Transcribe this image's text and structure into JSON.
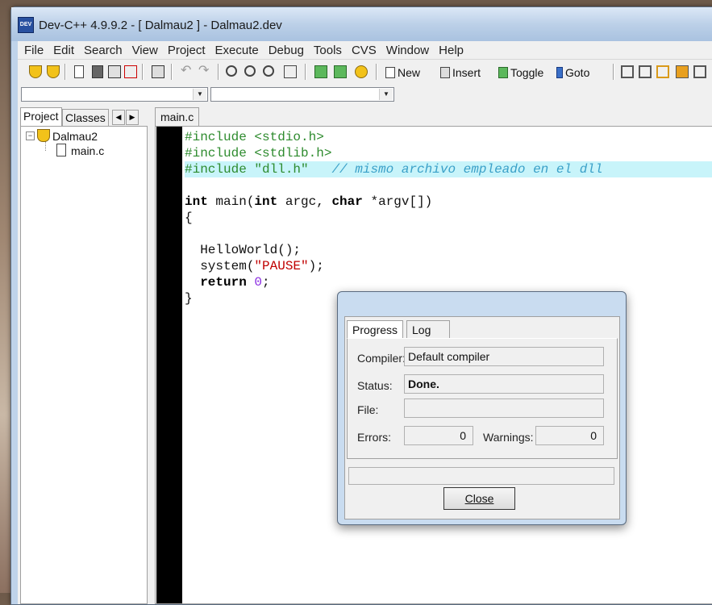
{
  "window": {
    "title": "Dev-C++ 4.9.9.2  -  [ Dalmau2 ] - Dalmau2.dev",
    "app_icon_text": "DEV"
  },
  "menu": [
    "File",
    "Edit",
    "Search",
    "View",
    "Project",
    "Execute",
    "Debug",
    "Tools",
    "CVS",
    "Window",
    "Help"
  ],
  "toolbar": {
    "new_label": "New",
    "insert_label": "Insert",
    "toggle_label": "Toggle",
    "goto_label": "Goto"
  },
  "left_panel": {
    "tabs": [
      "Project",
      "Classes"
    ],
    "active_tab": "Project",
    "tree": {
      "root": "Dalmau2",
      "children": [
        "main.c"
      ]
    }
  },
  "editor": {
    "tab": "main.c",
    "lines": [
      "#include <stdio.h>",
      "#include <stdlib.h>",
      "#include \"dll.h\"",
      "// mismo archivo empleado en el dll",
      "",
      "int main(int argc, char *argv[])",
      "{",
      "",
      "  HelloWorld();",
      "  system(\"PAUSE\");",
      "  return 0;",
      "}"
    ]
  },
  "dialog": {
    "tabs": [
      "Progress",
      "Log"
    ],
    "active_tab": "Progress",
    "compiler_label": "Compiler:",
    "compiler_value": "Default compiler",
    "status_label": "Status:",
    "status_value": "Done.",
    "file_label": "File:",
    "file_value": "",
    "errors_label": "Errors:",
    "errors_value": "0",
    "warnings_label": "Warnings:",
    "warnings_value": "0",
    "close_label": "Close"
  }
}
